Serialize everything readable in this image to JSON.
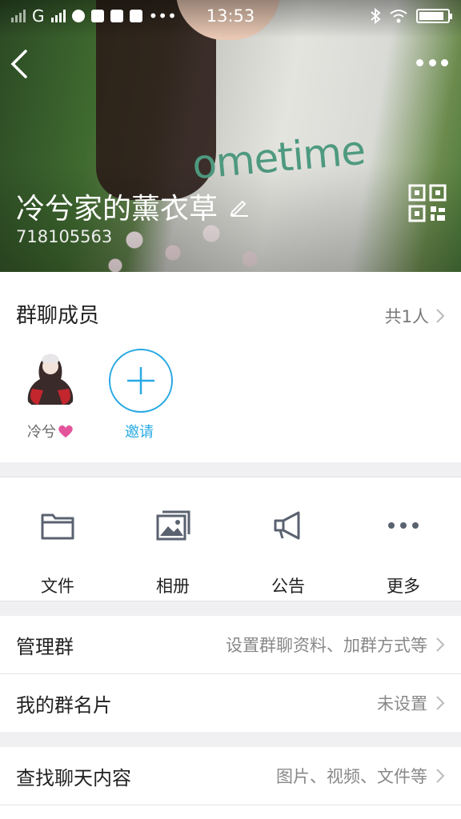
{
  "status_bar": {
    "carrier": "G",
    "time": "13:53",
    "icons": [
      "signal-icon",
      "wechat-icon",
      "s-app-icon",
      "mail-icon",
      "app-icon",
      "more-icon",
      "bluetooth-icon",
      "wifi-icon",
      "battery-icon"
    ]
  },
  "header": {
    "group_name": "冷兮家的薰衣草",
    "group_id": "718105563",
    "background_art_text": "ometime"
  },
  "members": {
    "title": "群聊成员",
    "count": "共1人",
    "member_name": "冷兮",
    "invite_label": "邀请"
  },
  "features": [
    {
      "label": "文件",
      "icon": "folder-icon"
    },
    {
      "label": "相册",
      "icon": "album-icon"
    },
    {
      "label": "公告",
      "icon": "announcement-icon"
    },
    {
      "label": "更多",
      "icon": "more-dots-icon"
    }
  ],
  "rows": [
    {
      "label": "管理群",
      "value": "设置群聊资料、加群方式等"
    },
    {
      "label": "我的群名片",
      "value": "未设置"
    },
    {
      "label": "查找聊天内容",
      "value": "图片、视频、文件等"
    }
  ],
  "colors": {
    "accent": "#27a9e3",
    "icon_gray": "#5a6270",
    "page_bg": "#f0f0f3"
  }
}
